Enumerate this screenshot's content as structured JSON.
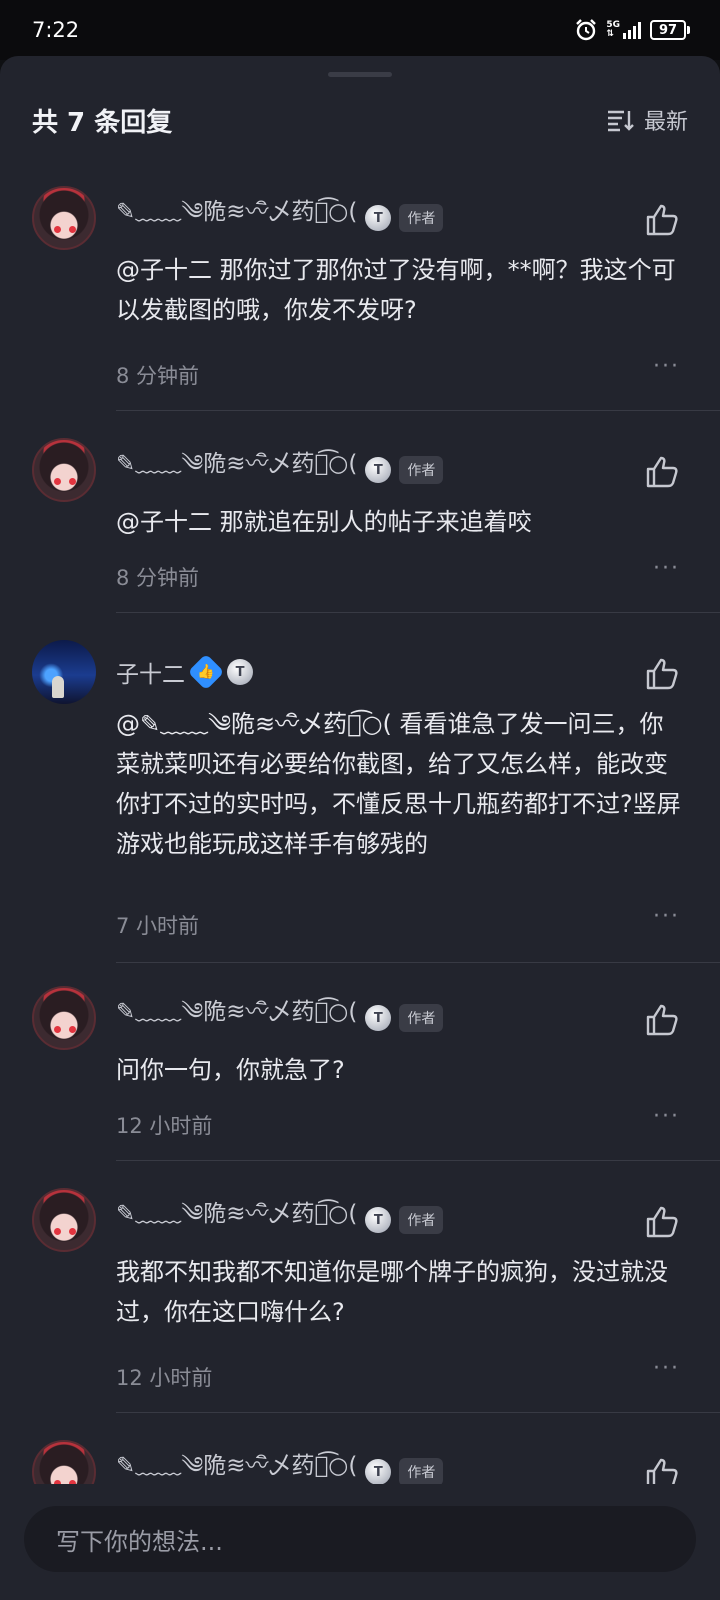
{
  "status_bar": {
    "time": "7:22",
    "network": "5G",
    "battery": "97"
  },
  "header": {
    "title": "共 7 条回复",
    "sort_label": "最新"
  },
  "comments": [
    {
      "username": "✎﹏﹏༄陒≋〰ิ乄药ั͡○(",
      "author_tag": "作者",
      "text": "@子十二  那你过了那你过了没有啊，**啊？我这个可以发截图的哦，你发不发呀?",
      "time": "8 分钟前"
    },
    {
      "username": "✎﹏﹏༄陒≋〰ิ乄药ั͡○(",
      "author_tag": "作者",
      "text": "@子十二  那就追在别人的帖子来追着咬",
      "time": "8 分钟前"
    },
    {
      "username": "子十二",
      "author_tag": "",
      "text": "@✎﹏﹏༄陒≋〰ิ乄药ั͡○( 看看谁急了发一问三，你菜就菜呗还有必要给你截图，给了又怎么样，能改变你打不过的实时吗，不懂反思十几瓶药都打不过?竖屏游戏也能玩成这样手有够残的",
      "time": "7 小时前"
    },
    {
      "username": "✎﹏﹏༄陒≋〰ิ乄药ั͡○(",
      "author_tag": "作者",
      "text": "问你一句，你就急了?",
      "time": "12 小时前"
    },
    {
      "username": "✎﹏﹏༄陒≋〰ิ乄药ั͡○(",
      "author_tag": "作者",
      "text": "我都不知我都不知道你是哪个牌子的疯狗，没过就没过，你在这口嗨什么?",
      "time": "12 小时前"
    },
    {
      "username": "✎﹏﹏༄陒≋〰ิ乄药ั͡○(",
      "author_tag": "作者",
      "text": "",
      "time": ""
    }
  ],
  "input": {
    "placeholder": "写下你的想法..."
  },
  "colors": {
    "sheet_bg": "#22242d",
    "accent_blue": "#2f8fff",
    "muted_text": "#8a8c96"
  }
}
